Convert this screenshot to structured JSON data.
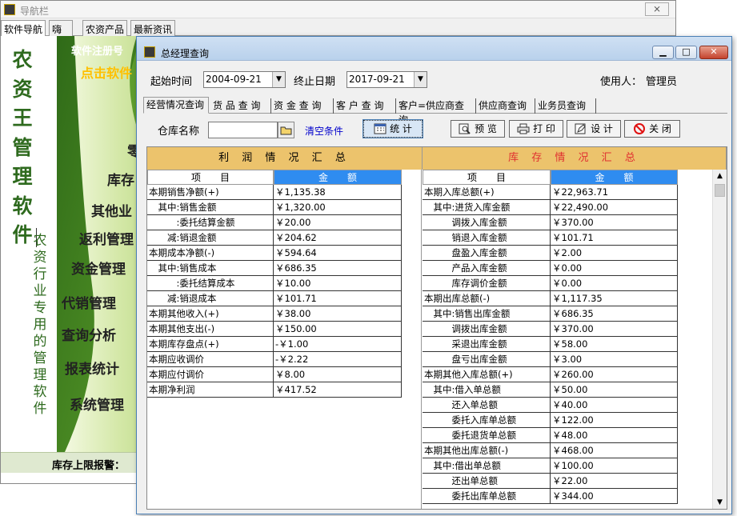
{
  "nav_window": {
    "title": "导航栏",
    "close": "⨯",
    "tabs": [
      "软件导航",
      "嗨网",
      "农资产品",
      "最新资讯"
    ],
    "app_name": "农资王管理软件",
    "tagline": "农资行业专用的管理软件",
    "register": "软件注册号",
    "click": "点击软件",
    "menu": [
      "零",
      "库存",
      "其他业",
      "返利管理",
      "资金管理",
      "代销管理",
      "查询分析",
      "报表统计",
      "系统管理"
    ],
    "alarm": "库存上限报警："
  },
  "window": {
    "title": "总经理查询",
    "minimize": "▁",
    "maximize": "□",
    "close": "✕"
  },
  "filters": {
    "start_label": "起始时间",
    "start_date": "2004-09-21",
    "end_label": "终止日期",
    "end_date": "2017-09-21",
    "user_label": "使用人：",
    "user": "管理员"
  },
  "tabs": [
    "经营情况查询",
    "货 品 查 询",
    "资 金 查 询",
    "客 户 查 询",
    "客户=供应商查询",
    "供应商查询",
    "业务员查询"
  ],
  "toolbar": {
    "warehouse_label": "仓库名称",
    "warehouse_value": "",
    "clear": "清空条件",
    "stat": "统 计",
    "preview": "预 览",
    "print": "打 印",
    "design": "设 计",
    "close": "关 闭"
  },
  "profit": {
    "title": "利 润 情 况 汇 总",
    "col_item": "项　　目",
    "col_amount": "金　　额",
    "rows": [
      [
        "本期销售净额(+)",
        "￥1,135.38"
      ],
      [
        "　其中:销售金额",
        "￥1,320.00"
      ],
      [
        "　　　:委托结算金额",
        "￥20.00"
      ],
      [
        "　　减:销退金额",
        "￥204.62"
      ],
      [
        "本期成本净额(-)",
        "￥594.64"
      ],
      [
        "　其中:销售成本",
        "￥686.35"
      ],
      [
        "　　　:委托结算成本",
        "￥10.00"
      ],
      [
        "　　减:销退成本",
        "￥101.71"
      ],
      [
        "本期其他收入(+)",
        "￥38.00"
      ],
      [
        "本期其他支出(-)",
        "￥150.00"
      ],
      [
        "本期库存盘点(+)",
        "-￥1.00"
      ],
      [
        "本期应收调价",
        "-￥2.22"
      ],
      [
        "本期应付调价",
        "￥8.00"
      ],
      [
        "本期净利润",
        "￥417.52"
      ]
    ]
  },
  "inventory": {
    "title": "库 存 情 况 汇 总",
    "col_item": "项　　目",
    "col_amount": "金　　额",
    "rows": [
      [
        "本期入库总额(+)",
        "￥22,963.71"
      ],
      [
        "　其中:进货入库金额",
        "￥22,490.00"
      ],
      [
        "　　　调拨入库金额",
        "￥370.00"
      ],
      [
        "　　　销退入库金额",
        "￥101.71"
      ],
      [
        "　　　盘盈入库金额",
        "￥2.00"
      ],
      [
        "　　　产品入库金额",
        "￥0.00"
      ],
      [
        "　　　库存调价金额",
        "￥0.00"
      ],
      [
        "本期出库总额(-)",
        "￥1,117.35"
      ],
      [
        "　其中:销售出库金额",
        "￥686.35"
      ],
      [
        "　　　调拨出库金额",
        "￥370.00"
      ],
      [
        "　　　采退出库金额",
        "￥58.00"
      ],
      [
        "　　　盘亏出库金额",
        "￥3.00"
      ],
      [
        "本期其他入库总额(+)",
        "￥260.00"
      ],
      [
        "　其中:借入单总额",
        "￥50.00"
      ],
      [
        "　　　还入单总额",
        "￥40.00"
      ],
      [
        "　　　委托入库单总额",
        "￥122.00"
      ],
      [
        "　　　委托退货单总额",
        "￥48.00"
      ],
      [
        "本期其他出库总额(-)",
        "￥468.00"
      ],
      [
        "　其中:借出单总额",
        "￥100.00"
      ],
      [
        "　　　还出单总额",
        "￥22.00"
      ],
      [
        "　　　委托出库单总额",
        "￥344.00"
      ]
    ]
  },
  "colors": {
    "header_bg": "#ecc36c",
    "amount_header_bg": "#2f8cf0",
    "inventory_title": "#e03030",
    "brand_green": "#2e6a1e"
  }
}
